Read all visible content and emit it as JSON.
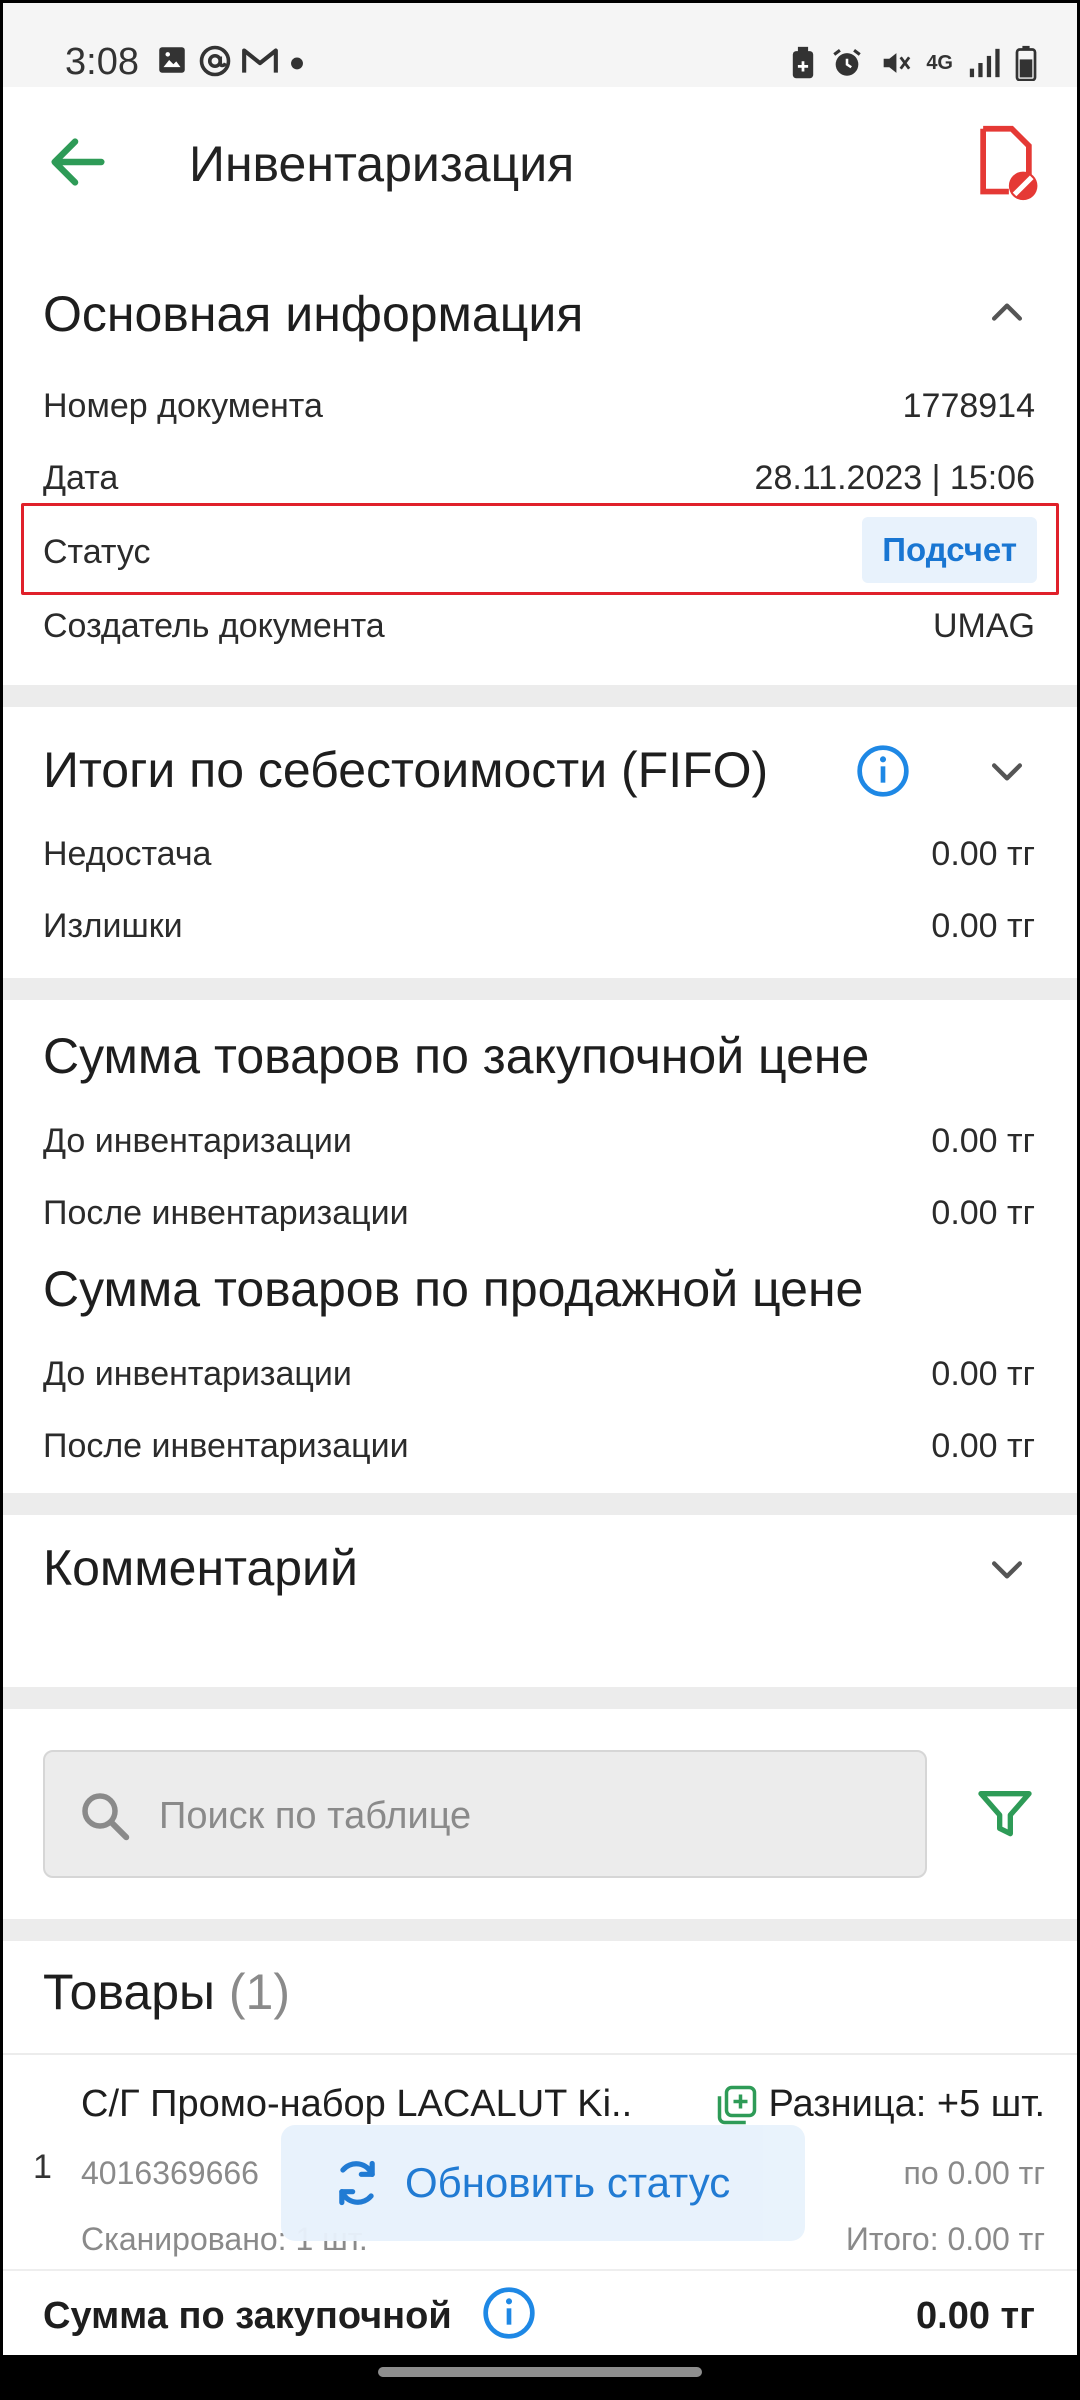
{
  "status_bar": {
    "time": "3:08",
    "left_icons": [
      "image-icon",
      "at-icon",
      "gmail-icon",
      "dot-icon"
    ],
    "right_icons": [
      "battery-saver-icon",
      "alarm-icon",
      "mute-icon",
      "network-4g-icon",
      "signal-icon",
      "battery-icon"
    ],
    "network_label": "4G"
  },
  "app_bar": {
    "title": "Инвентаризация",
    "back_icon": "arrow-back-icon",
    "action_icon": "document-cancel-icon",
    "accent": "#2e9b57",
    "danger": "#e53935"
  },
  "main_info": {
    "title": "Основная информация",
    "rows": [
      {
        "label": "Номер документа",
        "value": "1778914"
      },
      {
        "label": "Дата",
        "value": "28.11.2023 | 15:06"
      },
      {
        "label": "Статус",
        "value": "Подсчет"
      },
      {
        "label": "Создатель документа",
        "value": "UMAG"
      }
    ]
  },
  "fifo": {
    "title": "Итоги по себестоимости (FIFO)",
    "rows": [
      {
        "label": "Недостача",
        "value": "0.00 тг"
      },
      {
        "label": "Излишки",
        "value": "0.00 тг"
      }
    ]
  },
  "purchase_sum": {
    "title": "Сумма товаров по закупочной цене",
    "rows": [
      {
        "label": "До инвентаризации",
        "value": "0.00 тг"
      },
      {
        "label": "После инвентаризации",
        "value": "0.00 тг"
      }
    ]
  },
  "sale_sum": {
    "title": "Сумма товаров по продажной цене",
    "rows": [
      {
        "label": "До инвентаризации",
        "value": "0.00 тг"
      },
      {
        "label": "После инвентаризации",
        "value": "0.00 тг"
      }
    ]
  },
  "comment": {
    "title": "Комментарий"
  },
  "search": {
    "placeholder": "Поиск по таблице"
  },
  "goods": {
    "title": "Товары",
    "count": "(1)",
    "items": [
      {
        "index": "1",
        "name": "С/Г Промо-набор LACALUT Ki..",
        "difference": "Разница: +5 шт.",
        "code": "4016369666",
        "price": "по 0.00 тг",
        "scanned": "Сканировано: 1 шт.",
        "total": "Итого: 0.00 тг"
      }
    ]
  },
  "update_button": {
    "label": "Обновить статус"
  },
  "bottom": {
    "label": "Сумма по закупочной",
    "value": "0.00 тг"
  },
  "colors": {
    "primary_blue": "#1976d2",
    "badge_bg": "#e8f2fc",
    "highlight_red": "#e0202a",
    "green": "#2e9b57"
  }
}
